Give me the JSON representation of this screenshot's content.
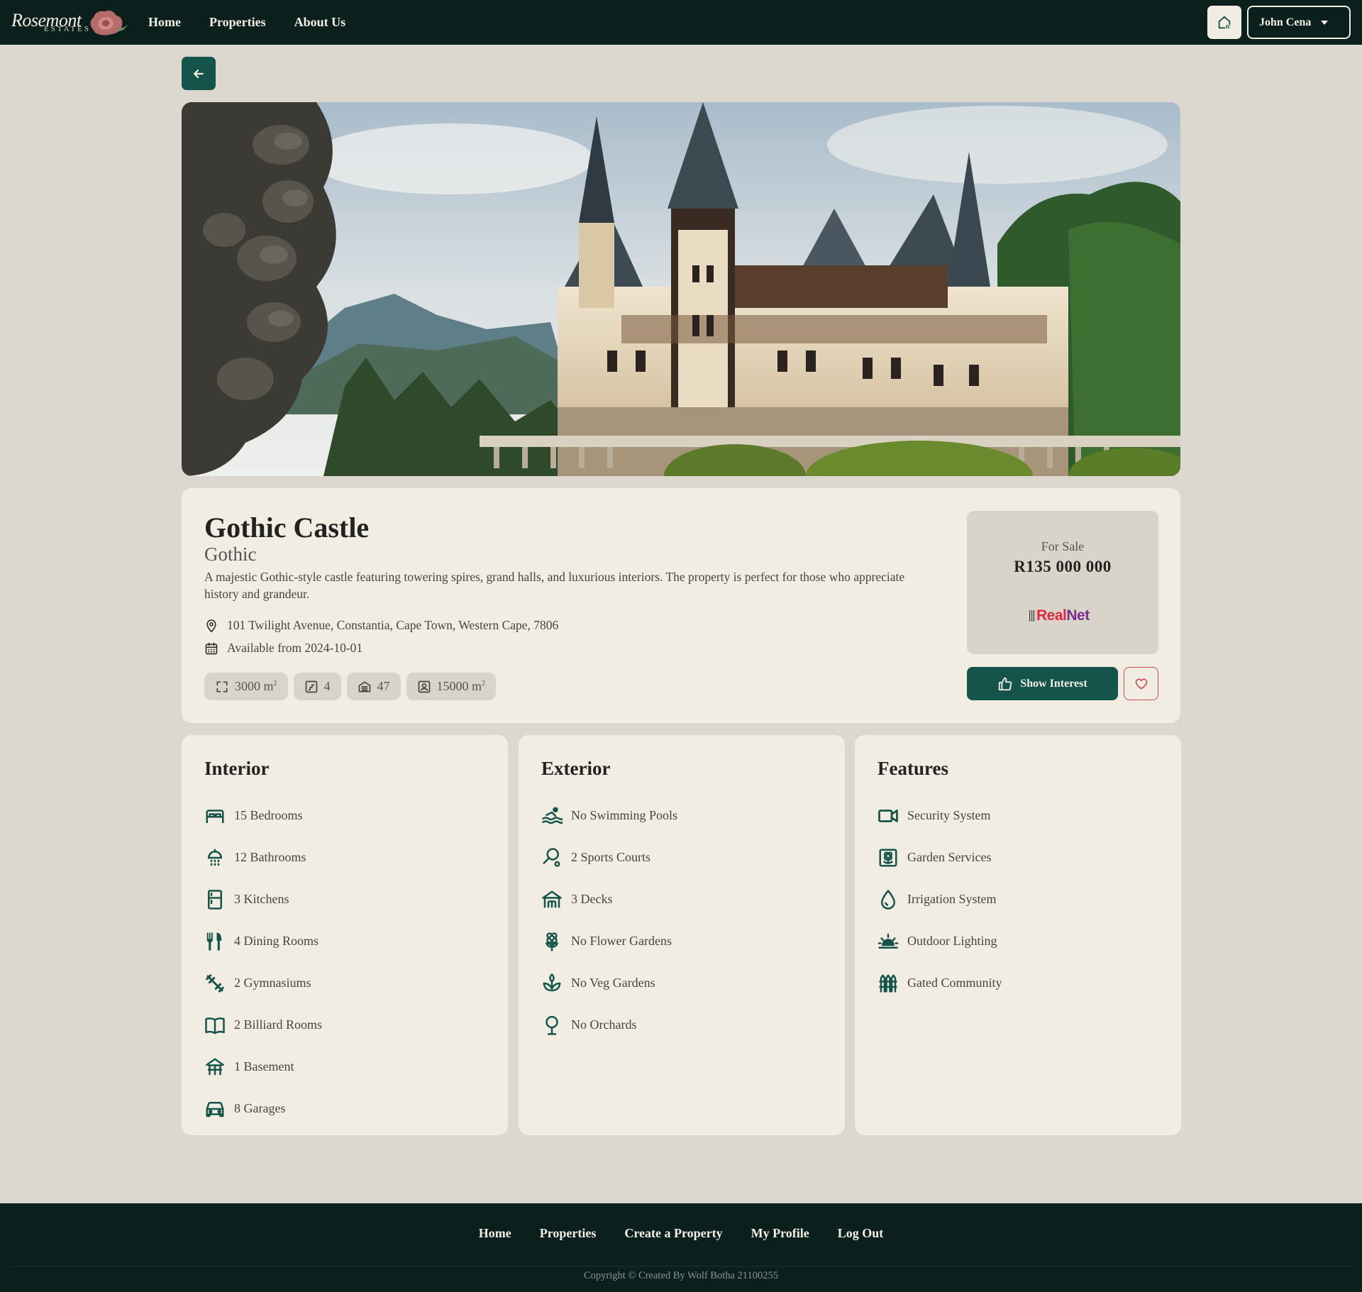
{
  "brand": {
    "name": "Rosemont",
    "sub": "ESTATES"
  },
  "nav": {
    "links": [
      "Home",
      "Properties",
      "About Us"
    ],
    "user": "John Cena"
  },
  "property": {
    "title": "Gothic Castle",
    "style": "Gothic",
    "description": "A majestic Gothic-style castle featuring towering spires, grand halls, and luxurious interiors. The property is perfect for those who appreciate history and grandeur.",
    "address": "101 Twilight Avenue, Constantia, Cape Town, Western Cape, 7806",
    "available": "Available from 2024-10-01",
    "chips": {
      "floor_size": "3000 m",
      "floor_unit": "2",
      "parking": "4",
      "level": "47",
      "erf_size": "15000 m",
      "erf_unit": "2"
    },
    "status": "For Sale",
    "price": "R135 000 000",
    "agency": {
      "part1": "Real",
      "part2": "Net"
    },
    "interest_button": "Show Interest"
  },
  "interior": {
    "title": "Interior",
    "items": [
      {
        "label": "15 Bedrooms",
        "icon": "bed-icon"
      },
      {
        "label": "12 Bathrooms",
        "icon": "shower-icon"
      },
      {
        "label": "3 Kitchens",
        "icon": "fridge-icon"
      },
      {
        "label": "4 Dining Rooms",
        "icon": "utensils-icon"
      },
      {
        "label": "2 Gymnasiums",
        "icon": "dumbbell-icon"
      },
      {
        "label": "2 Billiard Rooms",
        "icon": "book-icon"
      },
      {
        "label": "1 Basement",
        "icon": "basement-icon"
      },
      {
        "label": "8 Garages",
        "icon": "car-icon"
      }
    ]
  },
  "exterior": {
    "title": "Exterior",
    "items": [
      {
        "label": "No Swimming Pools",
        "icon": "pool-icon"
      },
      {
        "label": "2 Sports Courts",
        "icon": "racket-icon"
      },
      {
        "label": "3 Decks",
        "icon": "deck-icon"
      },
      {
        "label": "No Flower Gardens",
        "icon": "flower-icon"
      },
      {
        "label": "No Veg Gardens",
        "icon": "sprout-icon"
      },
      {
        "label": "No Orchards",
        "icon": "tree-icon"
      }
    ]
  },
  "features": {
    "title": "Features",
    "items": [
      {
        "label": "Security System",
        "icon": "camera-icon"
      },
      {
        "label": "Garden Services",
        "icon": "garden-icon"
      },
      {
        "label": "Irrigation System",
        "icon": "droplet-icon"
      },
      {
        "label": "Outdoor Lighting",
        "icon": "sunrise-icon"
      },
      {
        "label": "Gated Community",
        "icon": "fence-icon"
      }
    ]
  },
  "footer": {
    "links": [
      "Home",
      "Properties",
      "Create a Property",
      "My Profile",
      "Log Out"
    ],
    "copyright": "Copyright © Created By Wolf Botha 21100255"
  },
  "colors": {
    "nav_bg": "#0b1f1d",
    "accent": "#14544a",
    "card_bg": "#f2ede3",
    "page_bg": "#dcd8cf",
    "heart": "#c94b5b"
  }
}
